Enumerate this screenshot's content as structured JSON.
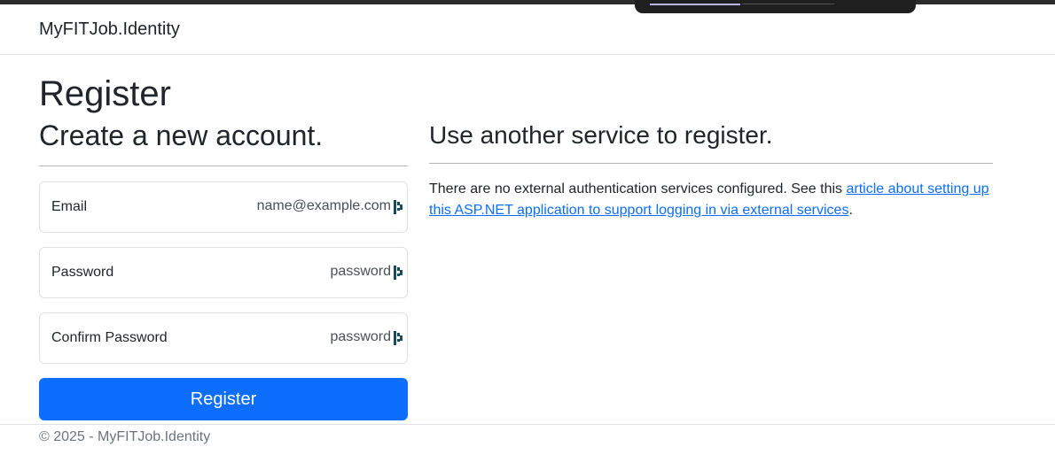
{
  "app": {
    "brand": "MyFITJob.Identity"
  },
  "page": {
    "title": "Register"
  },
  "register_form": {
    "heading": "Create a new account.",
    "email": {
      "label": "Email",
      "placeholder": "name@example.com",
      "value": ""
    },
    "password": {
      "label": "Password",
      "placeholder": "password",
      "value": ""
    },
    "confirm_password": {
      "label": "Confirm Password",
      "placeholder": "password",
      "value": ""
    },
    "submit_label": "Register",
    "field_icon": "password-manager-icon"
  },
  "external": {
    "heading": "Use another service to register.",
    "text_before": "There are no external authentication services configured. See this ",
    "link_text": "article about setting up this ASP.NET application to support logging in via external services",
    "text_after": "."
  },
  "footer": {
    "text": "© 2025 - MyFITJob.Identity"
  },
  "colors": {
    "primary": "#0d6efd",
    "text": "#212529",
    "muted": "#6c757d",
    "border": "#dee2e6"
  }
}
